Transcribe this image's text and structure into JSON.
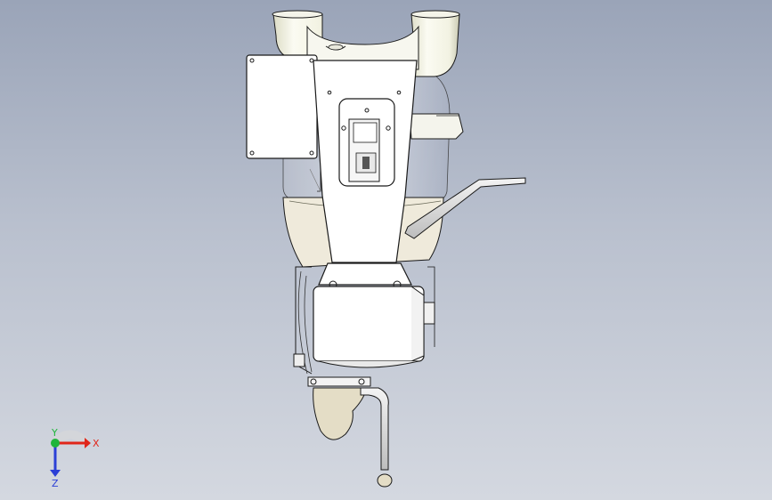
{
  "viewport": {
    "background_top": "#9aa4b8",
    "background_bottom": "#d4d8e0"
  },
  "model": {
    "body_fill": "#ffffff",
    "shadow_fill": "#d9d9c4",
    "outline": "#1a1a1a",
    "cream_fill": "#efeadb",
    "glass_fill": "#c8ceda"
  },
  "triad": {
    "x_label": "X",
    "y_label": "Y",
    "z_label": "Z",
    "x_color": "#e0261a",
    "y_color": "#1fb53a",
    "z_color": "#2b3fd6"
  }
}
